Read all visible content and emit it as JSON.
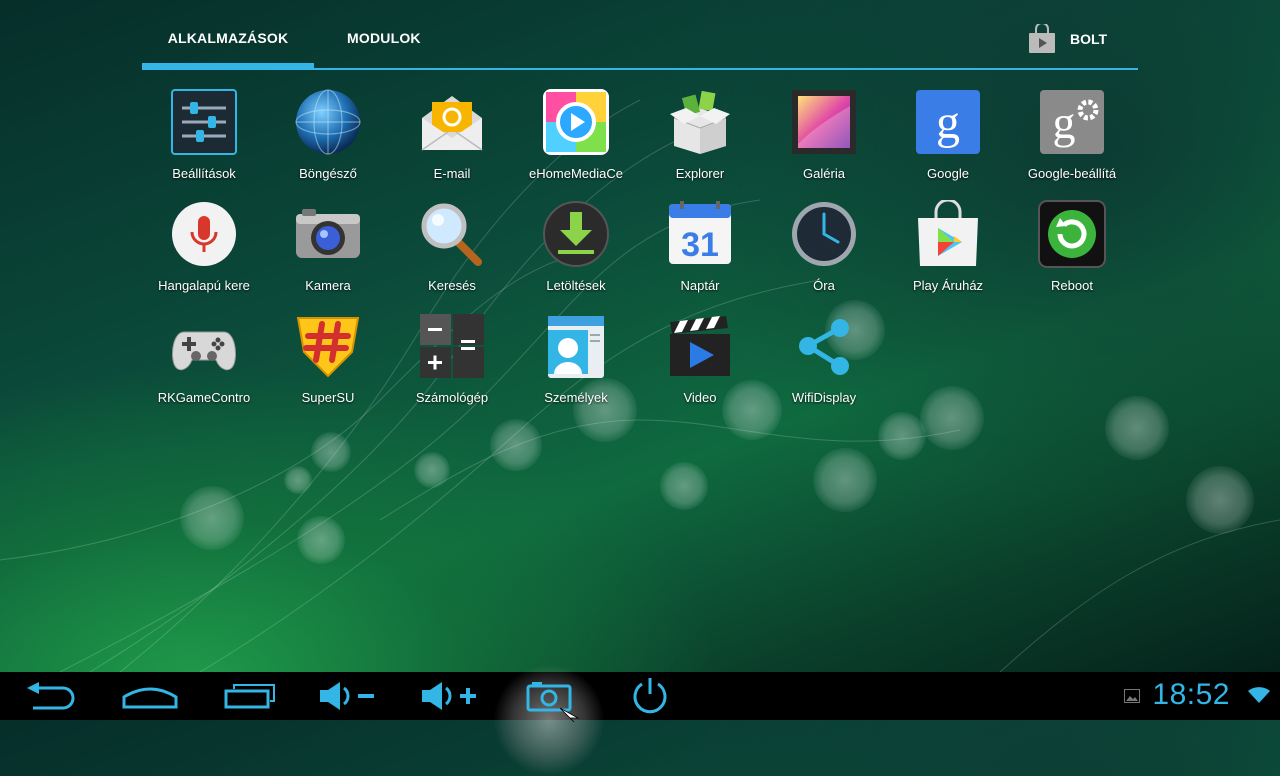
{
  "tabs": {
    "apps": "ALKALMAZÁSOK",
    "widgets": "MODULOK",
    "store": "BOLT"
  },
  "apps": [
    {
      "label": "Beállítások",
      "icon": "settings-icon"
    },
    {
      "label": "Böngésző",
      "icon": "browser-globe-icon"
    },
    {
      "label": "E-mail",
      "icon": "email-icon"
    },
    {
      "label": "eHomeMediaCe",
      "icon": "ehome-media-center-icon"
    },
    {
      "label": "Explorer",
      "icon": "explorer-box-icon"
    },
    {
      "label": "Galéria",
      "icon": "gallery-icon"
    },
    {
      "label": "Google",
      "icon": "google-icon"
    },
    {
      "label": "Google-beállítá",
      "icon": "google-settings-icon"
    },
    {
      "label": "Hangalapú kere",
      "icon": "voice-search-icon"
    },
    {
      "label": "Kamera",
      "icon": "camera-icon"
    },
    {
      "label": "Keresés",
      "icon": "search-icon"
    },
    {
      "label": "Letöltések",
      "icon": "downloads-icon"
    },
    {
      "label": "Naptár",
      "icon": "calendar-icon"
    },
    {
      "label": "Óra",
      "icon": "clock-icon"
    },
    {
      "label": "Play Áruház",
      "icon": "play-store-icon"
    },
    {
      "label": "Reboot",
      "icon": "reboot-icon"
    },
    {
      "label": "RKGameContro",
      "icon": "gamepad-icon"
    },
    {
      "label": "SuperSU",
      "icon": "supersu-icon"
    },
    {
      "label": "Számológép",
      "icon": "calculator-icon"
    },
    {
      "label": "Személyek",
      "icon": "contacts-icon"
    },
    {
      "label": "Video",
      "icon": "video-clapper-icon"
    },
    {
      "label": "WifiDisplay",
      "icon": "share-icon"
    }
  ],
  "calendar_day": "31",
  "navbar": {
    "buttons": [
      "back-icon",
      "home-icon",
      "recent-apps-icon",
      "volume-down-icon",
      "volume-up-icon",
      "screenshot-icon",
      "power-icon"
    ],
    "time": "18:52"
  },
  "colors": {
    "accent": "#33b5e5",
    "navbar": "#000000"
  }
}
